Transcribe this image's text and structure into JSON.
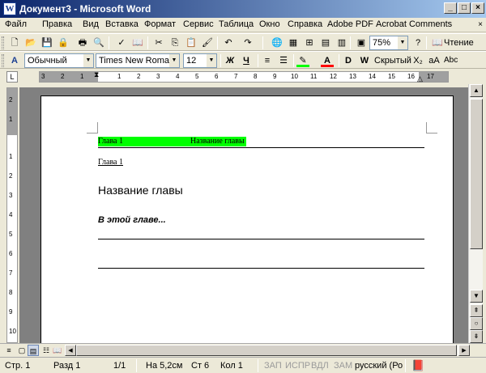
{
  "window": {
    "title": "Документ3 - Microsoft Word",
    "minimize": "_",
    "maximize": "□",
    "close": "×"
  },
  "menu": {
    "items": [
      "Файл",
      "Правка",
      "Вид",
      "Вставка",
      "Формат",
      "Сервис",
      "Таблица",
      "Окно",
      "Справка",
      "Adobe PDF",
      "Acrobat Comments"
    ],
    "close_doc": "×"
  },
  "toolbar_standard": {
    "zoom": "75%",
    "reading": "Чтение"
  },
  "toolbar_formatting": {
    "style": "Обычный",
    "font": "Times New Roman",
    "size": "12",
    "bold": "Ж",
    "italic": "К",
    "underline": "Ч",
    "font_color": "A",
    "hidden": "Скрытый",
    "abc": "Abc"
  },
  "ruler": {
    "tab_selector": "L",
    "numbers": [
      "3",
      "2",
      "1",
      "1",
      "2",
      "3",
      "4",
      "5",
      "6",
      "7",
      "8",
      "9",
      "10",
      "11",
      "12",
      "13",
      "14",
      "15",
      "16",
      "17"
    ],
    "vnumbers": [
      "2",
      "1",
      "1",
      "2",
      "3",
      "4",
      "5",
      "6",
      "7",
      "8",
      "9",
      "10"
    ]
  },
  "document": {
    "header_chapter": "Глава 1",
    "header_title": "Название главы",
    "chapter_label": "Глава 1",
    "chapter_title": "Название главы",
    "intro": "В этой главе..."
  },
  "status": {
    "page": "Стр.  1",
    "section": "Разд  1",
    "pages": "1/1",
    "at": "На 5,2см",
    "line": "Ст  6",
    "col": "Кол  1",
    "rec": "ЗАП",
    "trk": "ИСПР",
    "ext": "ВДЛ",
    "ovr": "ЗАМ",
    "language": "русский (Ро"
  },
  "colors": {
    "highlight": "#00ff00",
    "titlebar_start": "#0a246a",
    "titlebar_end": "#a6caf0"
  }
}
